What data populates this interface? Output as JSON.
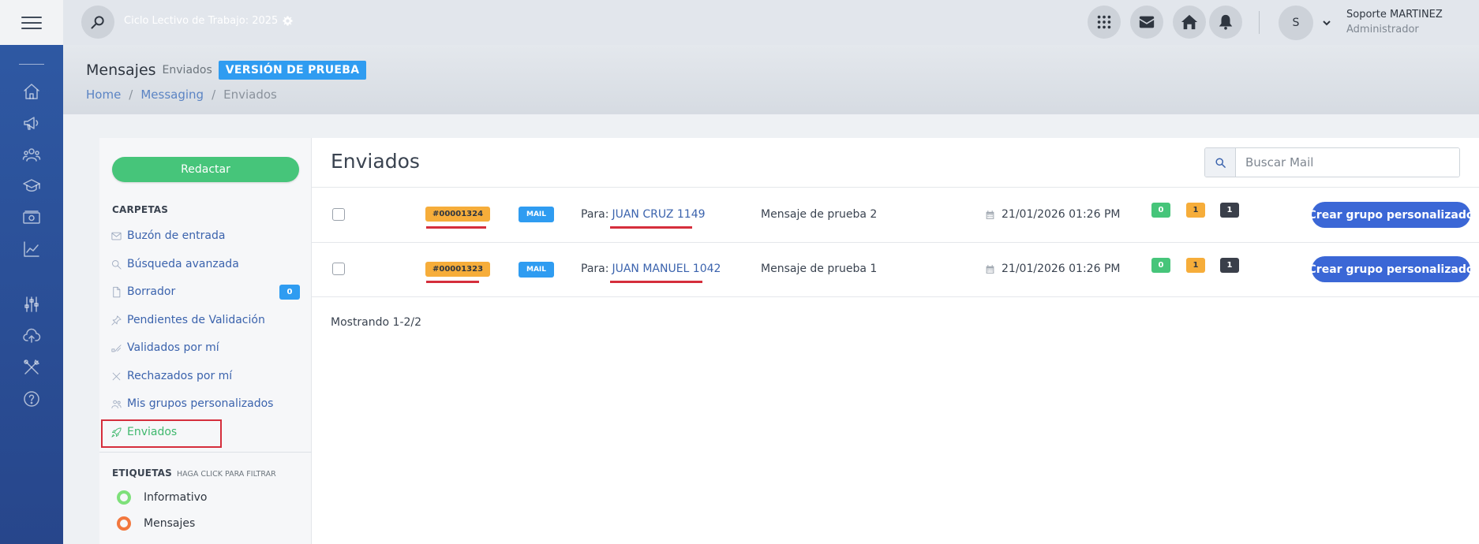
{
  "header": {
    "cycle_text": "Ciclo Lectivo de Trabajo: 2025",
    "user_initial": "S",
    "user_name": "Soporte MARTINEZ",
    "user_role": "Administrador"
  },
  "page": {
    "title": "Mensajes",
    "subtitle": "Enviados",
    "trial_badge": "VERSIÓN DE PRUEBA",
    "breadcrumbs": [
      "Home",
      "Messaging",
      "Enviados"
    ],
    "breadcrumb_separator": "/"
  },
  "sidebar": {
    "compose_label": "Redactar",
    "folders_title": "CARPETAS",
    "folders": [
      {
        "label": "Buzón de entrada",
        "icon": "inbox-icon"
      },
      {
        "label": "Búsqueda avanzada",
        "icon": "search-icon"
      },
      {
        "label": "Borrador",
        "icon": "file-icon",
        "count": "0"
      },
      {
        "label": "Pendientes de Validación",
        "icon": "pin-icon"
      },
      {
        "label": "Validados por mí",
        "icon": "check-icon"
      },
      {
        "label": "Rechazados por mí",
        "icon": "x-icon"
      },
      {
        "label": "Mis grupos personalizados",
        "icon": "users-icon"
      },
      {
        "label": "Enviados",
        "icon": "rocket-icon",
        "active": true
      }
    ],
    "tags_title": "ETIQUETAS",
    "tags_hint": "HAGA CLICK PARA FILTRAR",
    "tags": [
      {
        "label": "Informativo",
        "color": "#7ee07a"
      },
      {
        "label": "Mensajes",
        "color": "#f2773e"
      }
    ]
  },
  "main": {
    "title": "Enviados",
    "search_placeholder": "Buscar Mail",
    "para_label": "Para:",
    "channel_label": "MAIL",
    "action_label": "Crear grupo personalizado",
    "rows": [
      {
        "id": "#00001324",
        "recipient": "JUAN CRUZ 1149",
        "subject": "Mensaje de prueba 2",
        "date": "21/01/2026 01:26 PM",
        "green": "0",
        "yellow": "1",
        "dark": "1"
      },
      {
        "id": "#00001323",
        "recipient": "JUAN MANUEL 1042",
        "subject": "Mensaje de prueba 1",
        "date": "21/01/2026 01:26 PM",
        "green": "0",
        "yellow": "1",
        "dark": "1"
      }
    ],
    "showing": "Mostrando 1-2/2"
  },
  "colors": {
    "rail": "#2f5aa5",
    "accent_green": "#46c57a",
    "accent_blue": "#2f9cf1",
    "badge_yellow": "#f6ad3a",
    "button_blue": "#3b67d6",
    "highlight_red": "#d52e3c"
  }
}
